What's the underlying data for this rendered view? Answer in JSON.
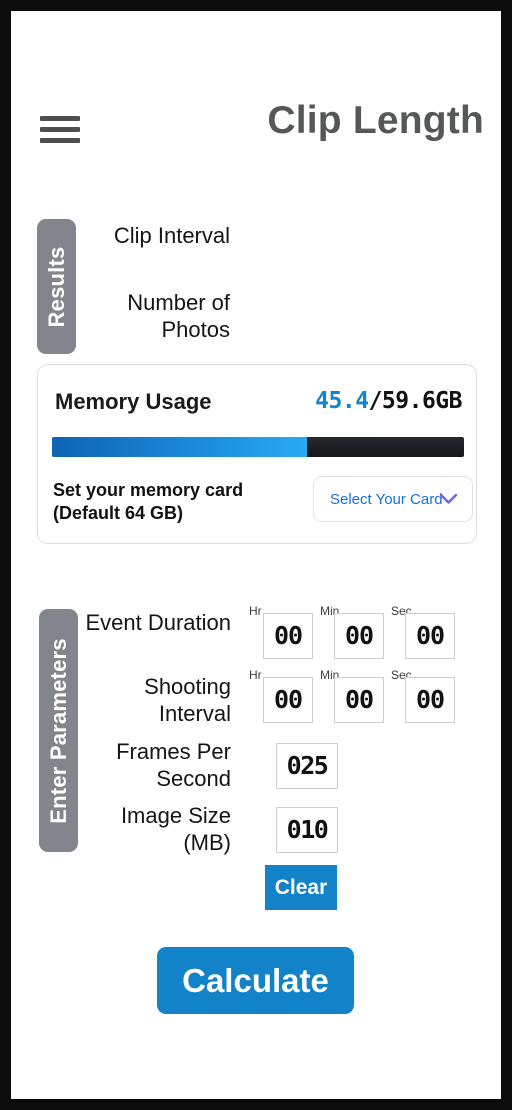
{
  "header": {
    "title": "Clip Length",
    "menu_icon": "hamburger-menu-icon"
  },
  "results": {
    "tab_label": "Results",
    "rows": [
      {
        "label": "Clip Interval",
        "value": ""
      },
      {
        "label": "Number of Photos",
        "value": ""
      }
    ]
  },
  "memory": {
    "title": "Memory Usage",
    "used": "45.4",
    "total": "/59.6GB",
    "used_color": "#1384c9",
    "total_color": "#111111",
    "bar_percent": 62,
    "bar_fill_start_color": "#0f63b4",
    "bar_fill_end_color": "#29aaf2",
    "bar_track_color": "#1e2126",
    "hint": "Set your memory card (Default 64 GB)",
    "select": {
      "label": "Select Your Card",
      "label_color": "#1470d6",
      "chevron_color": "#7b5ee8",
      "chevron_icon": "chevron-down-icon"
    }
  },
  "parameters": {
    "tab_label": "Enter Parameters",
    "event_duration": {
      "label": "Event Duration",
      "units": [
        {
          "tag": "Hr",
          "value": "00"
        },
        {
          "tag": "Min",
          "value": "00"
        },
        {
          "tag": "Sec",
          "value": "00"
        }
      ]
    },
    "shooting_interval": {
      "label": "Shooting Interval",
      "units": [
        {
          "tag": "Hr",
          "value": "00"
        },
        {
          "tag": "Min",
          "value": "00"
        },
        {
          "tag": "Sec",
          "value": "00"
        }
      ]
    },
    "frames_per_second": {
      "label": "Frames Per Second",
      "value": "025"
    },
    "image_size": {
      "label": "Image Size (MB)",
      "value": "010"
    },
    "clear_label": "Clear"
  },
  "actions": {
    "calculate_label": "Calculate",
    "accent_color": "#1283c8"
  }
}
